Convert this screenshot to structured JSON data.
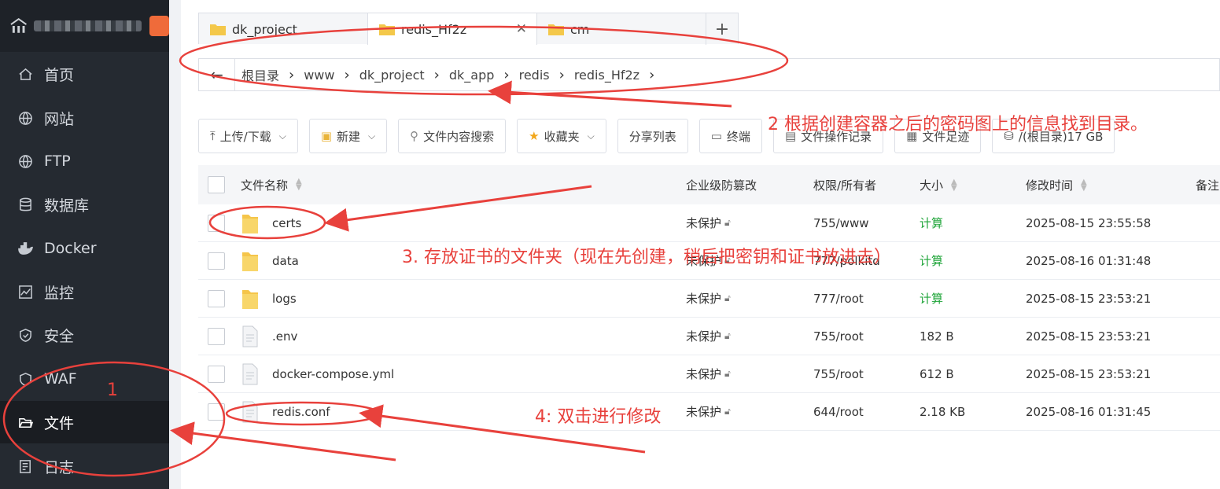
{
  "sidebar": {
    "items": [
      {
        "label": "首页",
        "icon": "home-icon"
      },
      {
        "label": "网站",
        "icon": "globe-icon"
      },
      {
        "label": "FTP",
        "icon": "globe-icon"
      },
      {
        "label": "数据库",
        "icon": "database-icon"
      },
      {
        "label": "Docker",
        "icon": "docker-icon"
      },
      {
        "label": "监控",
        "icon": "monitor-icon"
      },
      {
        "label": "安全",
        "icon": "shield-icon"
      },
      {
        "label": "WAF",
        "icon": "waf-shield-icon"
      },
      {
        "label": "文件",
        "icon": "folder-open-icon",
        "active": true
      },
      {
        "label": "日志",
        "icon": "log-icon"
      }
    ]
  },
  "tabs": [
    {
      "label": "dk_project"
    },
    {
      "label": "redis_Hf2z",
      "active": true
    },
    {
      "label": "cm"
    }
  ],
  "tab_add": "+",
  "breadcrumb": [
    "根目录",
    "www",
    "dk_project",
    "dk_app",
    "redis",
    "redis_Hf2z"
  ],
  "toolbar": {
    "upload": "上传/下载",
    "new": "新建",
    "search": "文件内容搜索",
    "favorites": "收藏夹",
    "share": "分享列表",
    "terminal": "终端",
    "oplog": "文件操作记录",
    "footprint": "文件足迹",
    "disk": "/(根目录)17 GB"
  },
  "table": {
    "headers": {
      "name": "文件名称",
      "protect": "企业级防篡改",
      "perm": "权限/所有者",
      "size": "大小",
      "mtime": "修改时间",
      "note": "备注"
    },
    "rows": [
      {
        "name": "certs",
        "type": "folder",
        "protect": "未保护",
        "perm": "755/www",
        "size": "计算",
        "mtime": "2025-08-15 23:55:58"
      },
      {
        "name": "data",
        "type": "folder",
        "protect": "未保护",
        "perm": "777/polkitd",
        "size": "计算",
        "mtime": "2025-08-16 01:31:48"
      },
      {
        "name": "logs",
        "type": "folder",
        "protect": "未保护",
        "perm": "777/root",
        "size": "计算",
        "mtime": "2025-08-15 23:53:21"
      },
      {
        "name": ".env",
        "type": "file",
        "protect": "未保护",
        "perm": "755/root",
        "size": "182 B",
        "mtime": "2025-08-15 23:53:21"
      },
      {
        "name": "docker-compose.yml",
        "type": "file",
        "protect": "未保护",
        "perm": "755/root",
        "size": "612 B",
        "mtime": "2025-08-15 23:53:21"
      },
      {
        "name": "redis.conf",
        "type": "file",
        "protect": "未保护",
        "perm": "644/root",
        "size": "2.18 KB",
        "mtime": "2025-08-16 01:31:45"
      }
    ]
  },
  "annotations": {
    "a1": "1",
    "a2": "2 根据创建容器之后的密码图上的信息找到目录。",
    "a3": "3. 存放证书的文件夹（现在先创建，稍后把密钥和证书放进去）",
    "a4": "4: 双击进行修改"
  },
  "colors": {
    "sidebar_bg": "#252a31",
    "accent_green": "#20a53a",
    "annotation_red": "#e8413c"
  }
}
